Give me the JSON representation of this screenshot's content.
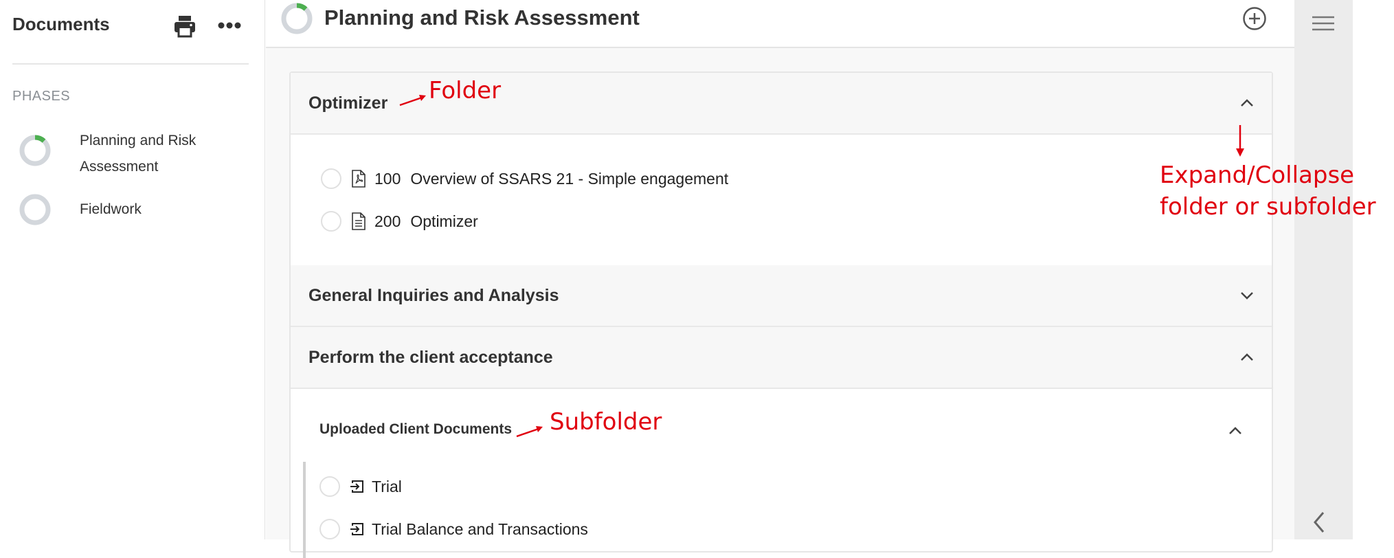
{
  "sidebar": {
    "title": "Documents",
    "section_label": "PHASES",
    "phases": [
      {
        "label": "Planning and Risk Assessment",
        "progress": 0.12
      },
      {
        "label": "Fieldwork",
        "progress": 0
      }
    ]
  },
  "header": {
    "title": "Planning and Risk Assessment",
    "progress": 0.12
  },
  "folders": [
    {
      "name": "Optimizer",
      "expanded": true,
      "documents": [
        {
          "number": "100",
          "title": "Overview of SSARS 21 - Simple engagement",
          "icon": "pdf-file-icon"
        },
        {
          "number": "200",
          "title": "Optimizer",
          "icon": "text-file-icon"
        }
      ]
    },
    {
      "name": "General Inquiries and Analysis",
      "expanded": false
    },
    {
      "name": "Perform the client acceptance",
      "expanded": true,
      "subfolders": [
        {
          "name": "Uploaded Client Documents",
          "expanded": true,
          "documents": [
            {
              "title": "Trial",
              "icon": "import-icon"
            },
            {
              "title": "Trial Balance and Transactions",
              "icon": "import-icon"
            }
          ]
        }
      ]
    }
  ],
  "annotations": {
    "folder": "Folder",
    "subfolder": "Subfolder",
    "expand_line1": "Expand/Collapse",
    "expand_line2": "folder or subfolder"
  },
  "colors": {
    "accent_green": "#4caf50",
    "ring_gray": "#d3d7dc",
    "annotation_red": "#e0000f"
  }
}
